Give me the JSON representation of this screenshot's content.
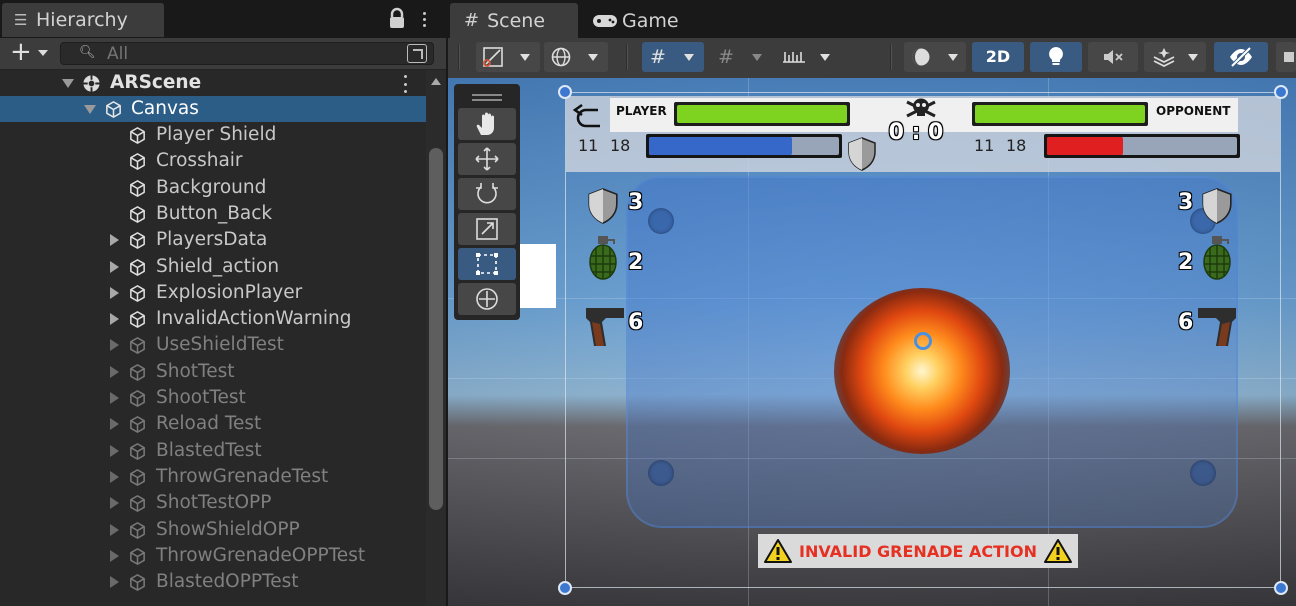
{
  "hierarchy": {
    "tab_title": "Hierarchy",
    "search_placeholder": "All",
    "root": "ARScene",
    "selected": "Canvas",
    "children": [
      {
        "label": "Player Shield",
        "expandable": false,
        "active": true
      },
      {
        "label": "Crosshair",
        "expandable": false,
        "active": true
      },
      {
        "label": "Background",
        "expandable": false,
        "active": true
      },
      {
        "label": "Button_Back",
        "expandable": false,
        "active": true
      },
      {
        "label": "PlayersData",
        "expandable": true,
        "active": true
      },
      {
        "label": "Shield_action",
        "expandable": true,
        "active": true
      },
      {
        "label": "ExplosionPlayer",
        "expandable": true,
        "active": true
      },
      {
        "label": "InvalidActionWarning",
        "expandable": true,
        "active": true
      },
      {
        "label": "UseShieldTest",
        "expandable": true,
        "active": false
      },
      {
        "label": "ShotTest",
        "expandable": true,
        "active": false
      },
      {
        "label": "ShootTest",
        "expandable": true,
        "active": false
      },
      {
        "label": "Reload Test",
        "expandable": true,
        "active": false
      },
      {
        "label": "BlastedTest",
        "expandable": true,
        "active": false
      },
      {
        "label": "ThrowGrenadeTest",
        "expandable": true,
        "active": false
      },
      {
        "label": "ShotTestOPP",
        "expandable": true,
        "active": false
      },
      {
        "label": "ShowShieldOPP",
        "expandable": true,
        "active": false
      },
      {
        "label": "ThrowGrenadeOPPTest",
        "expandable": true,
        "active": false
      },
      {
        "label": "BlastedOPPTest",
        "expandable": true,
        "active": false
      }
    ]
  },
  "scene": {
    "tabs": [
      "Scene",
      "Game"
    ],
    "active_tab": "Scene",
    "toolbar": {
      "mode_2d_label": "2D"
    },
    "tools": [
      "hand-tool",
      "move-tool",
      "rotate-tool",
      "scale-tool",
      "rect-tool",
      "transform-tool"
    ],
    "active_tool": "rect-tool"
  },
  "game_ui": {
    "player_label": "PLAYER",
    "opponent_label": "OPPONENT",
    "player_ammo": "11",
    "player_max_ammo": "18",
    "opponent_ammo": "11",
    "opponent_max_ammo": "18",
    "score": "0 : 0",
    "player_health_fraction": 1.0,
    "opponent_health_fraction": 1.0,
    "player_shield_fraction": 0.75,
    "opponent_shield_fraction": 0.4,
    "player_shields": "3",
    "player_grenades": "2",
    "player_bullets": "6",
    "opponent_shields": "3",
    "opponent_grenades": "2",
    "opponent_bullets": "6",
    "warning_text": "INVALID GRENADE ACTION"
  },
  "colors": {
    "health": "#7ed321",
    "player_shield": "#3568c8",
    "opponent_shield": "#e02020",
    "bar_empty": "#98a4b8",
    "selection": "#2c5d87",
    "accent_blue": "#3a5b81",
    "warning_red": "#e53022"
  }
}
